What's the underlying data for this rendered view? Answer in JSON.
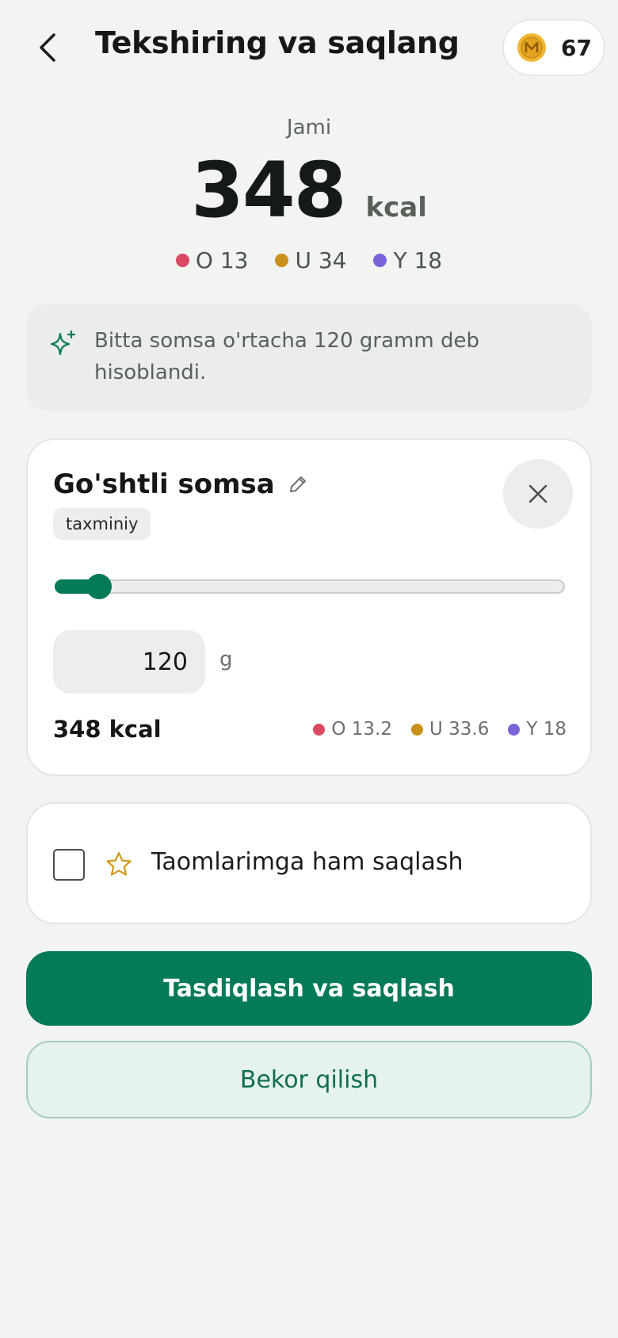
{
  "header": {
    "title": "Tekshiring va saqlang",
    "coins": "67"
  },
  "total": {
    "label": "Jami",
    "value": "348",
    "unit": "kcal",
    "macros": [
      {
        "text": "O 13",
        "color": "#d94a62"
      },
      {
        "text": "U 34",
        "color": "#c9911c"
      },
      {
        "text": "Y 18",
        "color": "#7a63d6"
      }
    ]
  },
  "info": {
    "text": "Bitta somsa o'rtacha 120 gramm deb hisoblandi."
  },
  "item": {
    "name": "Go'shtli somsa",
    "badge": "taxminiy",
    "slider_fraction": 0.087,
    "grams": "120",
    "grams_unit": "g",
    "kcal": "348 kcal",
    "macros": [
      {
        "text": "O 13.2",
        "color": "#d94a62"
      },
      {
        "text": "U 33.6",
        "color": "#c9911c"
      },
      {
        "text": "Y 18",
        "color": "#7a63d6"
      }
    ]
  },
  "favorite": {
    "label": "Taomlarimga ham saqlash",
    "checked": false
  },
  "actions": {
    "confirm_label": "Tasdiqlash va saqlash",
    "cancel_label": "Bekor qilish"
  },
  "colors": {
    "primary": "#047a58",
    "background": "#f2f4f2"
  },
  "icons": {
    "back": "chevron-left-icon",
    "coin": "coin-icon",
    "sparkle": "sparkle-icon",
    "edit": "pencil-icon",
    "close": "close-icon",
    "star": "star-icon"
  }
}
